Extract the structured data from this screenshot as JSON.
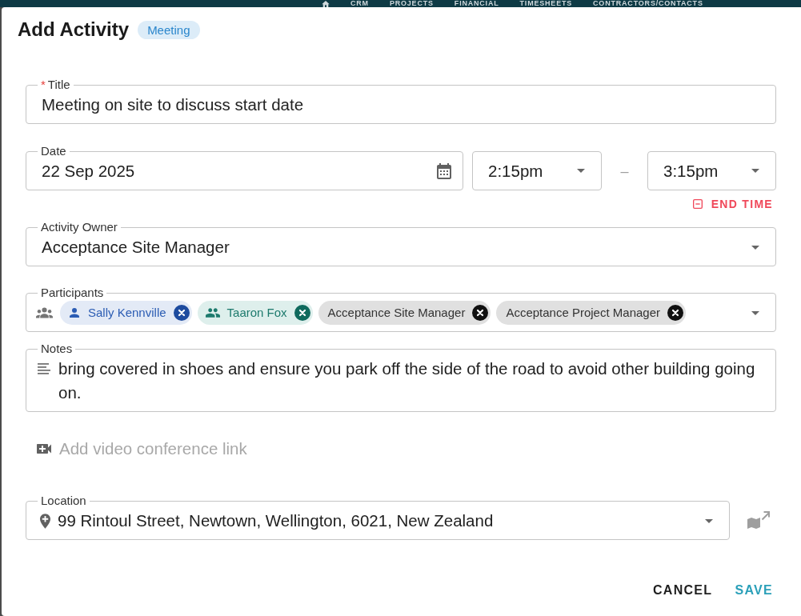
{
  "nav": {
    "items": [
      "CRM",
      "PROJECTS",
      "FINANCIAL",
      "TIMESHEETS",
      "CONTRACTORS/CONTACTS"
    ]
  },
  "dialog": {
    "title": "Add Activity",
    "type_badge": "Meeting"
  },
  "form": {
    "title_field": {
      "label": "Title",
      "required_mark": "*",
      "value": "Meeting on site to discuss start date"
    },
    "date_field": {
      "label": "Date",
      "value": "22 Sep 2025"
    },
    "start_time": {
      "value": "2:15pm"
    },
    "time_separator": "–",
    "end_time": {
      "value": "3:15pm"
    },
    "end_time_toggle": {
      "label": "END TIME"
    },
    "owner_field": {
      "label": "Activity Owner",
      "value": "Acceptance Site Manager"
    },
    "participants_field": {
      "label": "Participants",
      "chips": [
        {
          "kind": "person",
          "label": "Sally Kennville"
        },
        {
          "kind": "team",
          "label": "Taaron Fox"
        },
        {
          "kind": "role",
          "label": "Acceptance Site Manager"
        },
        {
          "kind": "role",
          "label": "Acceptance Project Manager"
        }
      ]
    },
    "notes_field": {
      "label": "Notes",
      "value": "bring covered in shoes and ensure you park off the side of the road to avoid other building going on."
    },
    "video_link": {
      "label": "Add video conference link"
    },
    "location_field": {
      "label": "Location",
      "value": "99 Rintoul Street, Newtown, Wellington, 6021, New Zealand"
    }
  },
  "buttons": [
    {
      "kind": "secondary",
      "label": "CANCEL"
    },
    {
      "kind": "primary",
      "label": "SAVE"
    }
  ]
}
